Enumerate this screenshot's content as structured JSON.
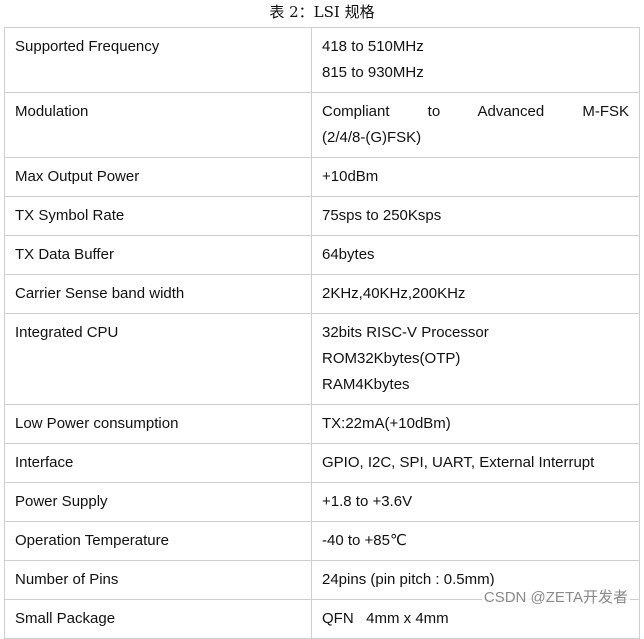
{
  "caption": "表 2：LSI 规格",
  "rows": [
    {
      "label": "Supported Frequency",
      "values": [
        "418 to 510MHz",
        "815 to 930MHz"
      ]
    },
    {
      "label": "Modulation",
      "values": [
        "Compliant to Advanced M-FSK",
        "(2/4/8-(G)FSK)"
      ]
    },
    {
      "label": "Max Output Power",
      "values": [
        "+10dBm"
      ]
    },
    {
      "label": "TX Symbol Rate",
      "values": [
        "75sps to 250Ksps"
      ]
    },
    {
      "label": "TX Data Buffer",
      "values": [
        "64bytes"
      ]
    },
    {
      "label": "Carrier Sense band width",
      "values": [
        "2KHz,40KHz,200KHz"
      ]
    },
    {
      "label": "Integrated CPU",
      "values": [
        "32bits RISC-V Processor",
        "ROM32Kbytes(OTP)",
        "RAM4Kbytes"
      ]
    },
    {
      "label": "Low Power consumption",
      "values": [
        "TX:22mA(+10dBm)"
      ]
    },
    {
      "label": "Interface",
      "values": [
        "GPIO, I2C, SPI, UART, External Interrupt"
      ]
    },
    {
      "label": "Power Supply",
      "values": [
        "+1.8 to +3.6V"
      ]
    },
    {
      "label": "Operation Temperature",
      "values": [
        "-40 to +85℃"
      ]
    },
    {
      "label": "Number of Pins",
      "values": [
        "24pins (pin pitch : 0.5mm)"
      ]
    },
    {
      "label": "Small Package",
      "values": [
        "QFN   4mm x 4mm"
      ]
    }
  ],
  "watermark": "CSDN @ZETA开发者"
}
